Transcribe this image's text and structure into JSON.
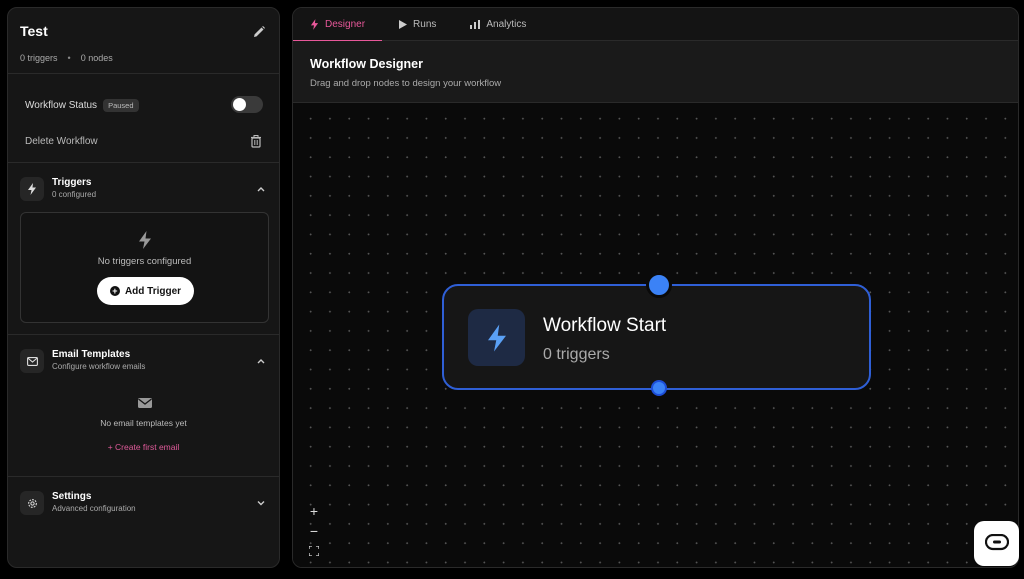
{
  "sidebar": {
    "title": "Test",
    "triggers_count": "0 triggers",
    "nodes_count": "0 nodes",
    "separator": "•",
    "status_label": "Workflow Status",
    "status_badge": "Paused",
    "delete_label": "Delete Workflow",
    "triggers_section": {
      "title": "Triggers",
      "subtitle": "0 configured",
      "empty_text": "No triggers configured",
      "add_button": "Add Trigger"
    },
    "email_section": {
      "title": "Email Templates",
      "subtitle": "Configure workflow emails",
      "empty_text": "No email templates yet",
      "create_link": "+ Create first email"
    },
    "settings_section": {
      "title": "Settings",
      "subtitle": "Advanced configuration"
    }
  },
  "tabs": [
    {
      "label": "Designer",
      "icon": "bolt-icon",
      "active": true
    },
    {
      "label": "Runs",
      "icon": "play-icon",
      "active": false
    },
    {
      "label": "Analytics",
      "icon": "bar-chart-icon",
      "active": false
    }
  ],
  "designer": {
    "title": "Workflow Designer",
    "subtitle": "Drag and drop nodes to design your workflow"
  },
  "node": {
    "title": "Workflow Start",
    "subtitle": "0 triggers"
  },
  "zoom": {
    "in": "+",
    "out": "−"
  },
  "colors": {
    "accent": "#e8589a",
    "node_border": "#2f5fd6",
    "handle": "#3b82f6"
  }
}
